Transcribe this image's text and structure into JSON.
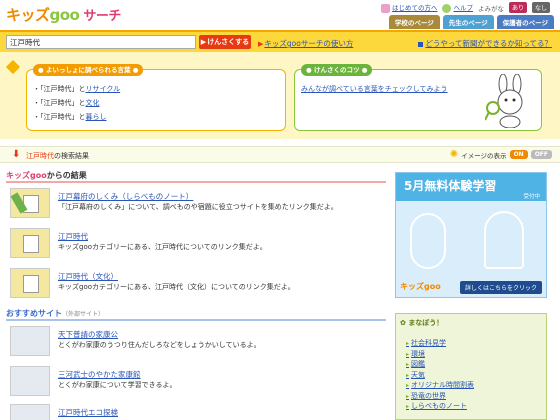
{
  "header": {
    "logo_part1": "キッズ",
    "logo_part2": "goo",
    "logo_part3": "サーチ",
    "top_links": {
      "first_time": "はじめての方へ",
      "help": "ヘルプ",
      "yomigana_label": "よみがな",
      "yomigana_on": "あり",
      "yomigana_off": "なし"
    },
    "tabs": [
      "学校のページ",
      "先生のページ",
      "保護者のページ"
    ]
  },
  "search": {
    "query": "江戸時代",
    "button_label": "けんさくする",
    "howto_label": "キッズgooサーチの使い方",
    "news_link": "どうやって新聞ができるか知ってる？"
  },
  "tips": {
    "box1_title": "よいっしょに調べられる言葉",
    "related": [
      {
        "prefix": "・「江戸時代」と",
        "word": "リサイクル"
      },
      {
        "prefix": "・「江戸時代」と",
        "word": "文化"
      },
      {
        "prefix": "・「江戸時代」と",
        "word": "暮らし"
      }
    ],
    "box2_title": "けんさくのコツ",
    "box2_link": "みんなが調べている言葉をチェックしてみよう"
  },
  "results_header": {
    "keyword": "江戸時代",
    "suffix": "の検索結果",
    "image_display_label": "イメージの表示",
    "on": "ON",
    "off": "OFF"
  },
  "kids_section": {
    "title_brand": "キッズgoo",
    "title_rest": "からの結果",
    "items": [
      {
        "title": "江戸幕府のしくみ（しらべものノート）",
        "desc": "「江戸幕府のしくみ」について、調べものや宿題に役立つサイトを集めたリンク集だよ。"
      },
      {
        "title": "江戸時代",
        "desc": "キッズgooカテゴリーにある、江戸時代についてのリンク集だよ。"
      },
      {
        "title": "江戸時代（文化）",
        "desc": "キッズgooカテゴリーにある、江戸時代（文化）についてのリンク集だよ。"
      }
    ]
  },
  "recommended_section": {
    "title": "おすすめサイト",
    "sub": "（外部サイト）",
    "items": [
      {
        "title": "天下普請の家康公",
        "desc": "とくがわ家康のうつり住んだしろなどをしょうかいしているよ。"
      },
      {
        "title": "三河武士のやかた家康館",
        "desc": "とくがわ家康について学習できるよ。"
      },
      {
        "title": "江戸時代エコ探検",
        "desc": ""
      }
    ]
  },
  "banner": {
    "title": "5月無料体験学習",
    "sub": "受付中",
    "logo": "キッズgoo",
    "button": "詳しくはこちらをクリック"
  },
  "learn": {
    "title": "まなぼう！",
    "items": [
      "社会科見学",
      "環境",
      "図鑑",
      "天気",
      "オリジナル時間割表",
      "恐竜の世界",
      "しらべものノート"
    ]
  },
  "colors": {
    "accent_orange": "#f08800",
    "search_bar": "#fdd83c",
    "search_button": "#e83a12",
    "link": "#2a55b8"
  }
}
